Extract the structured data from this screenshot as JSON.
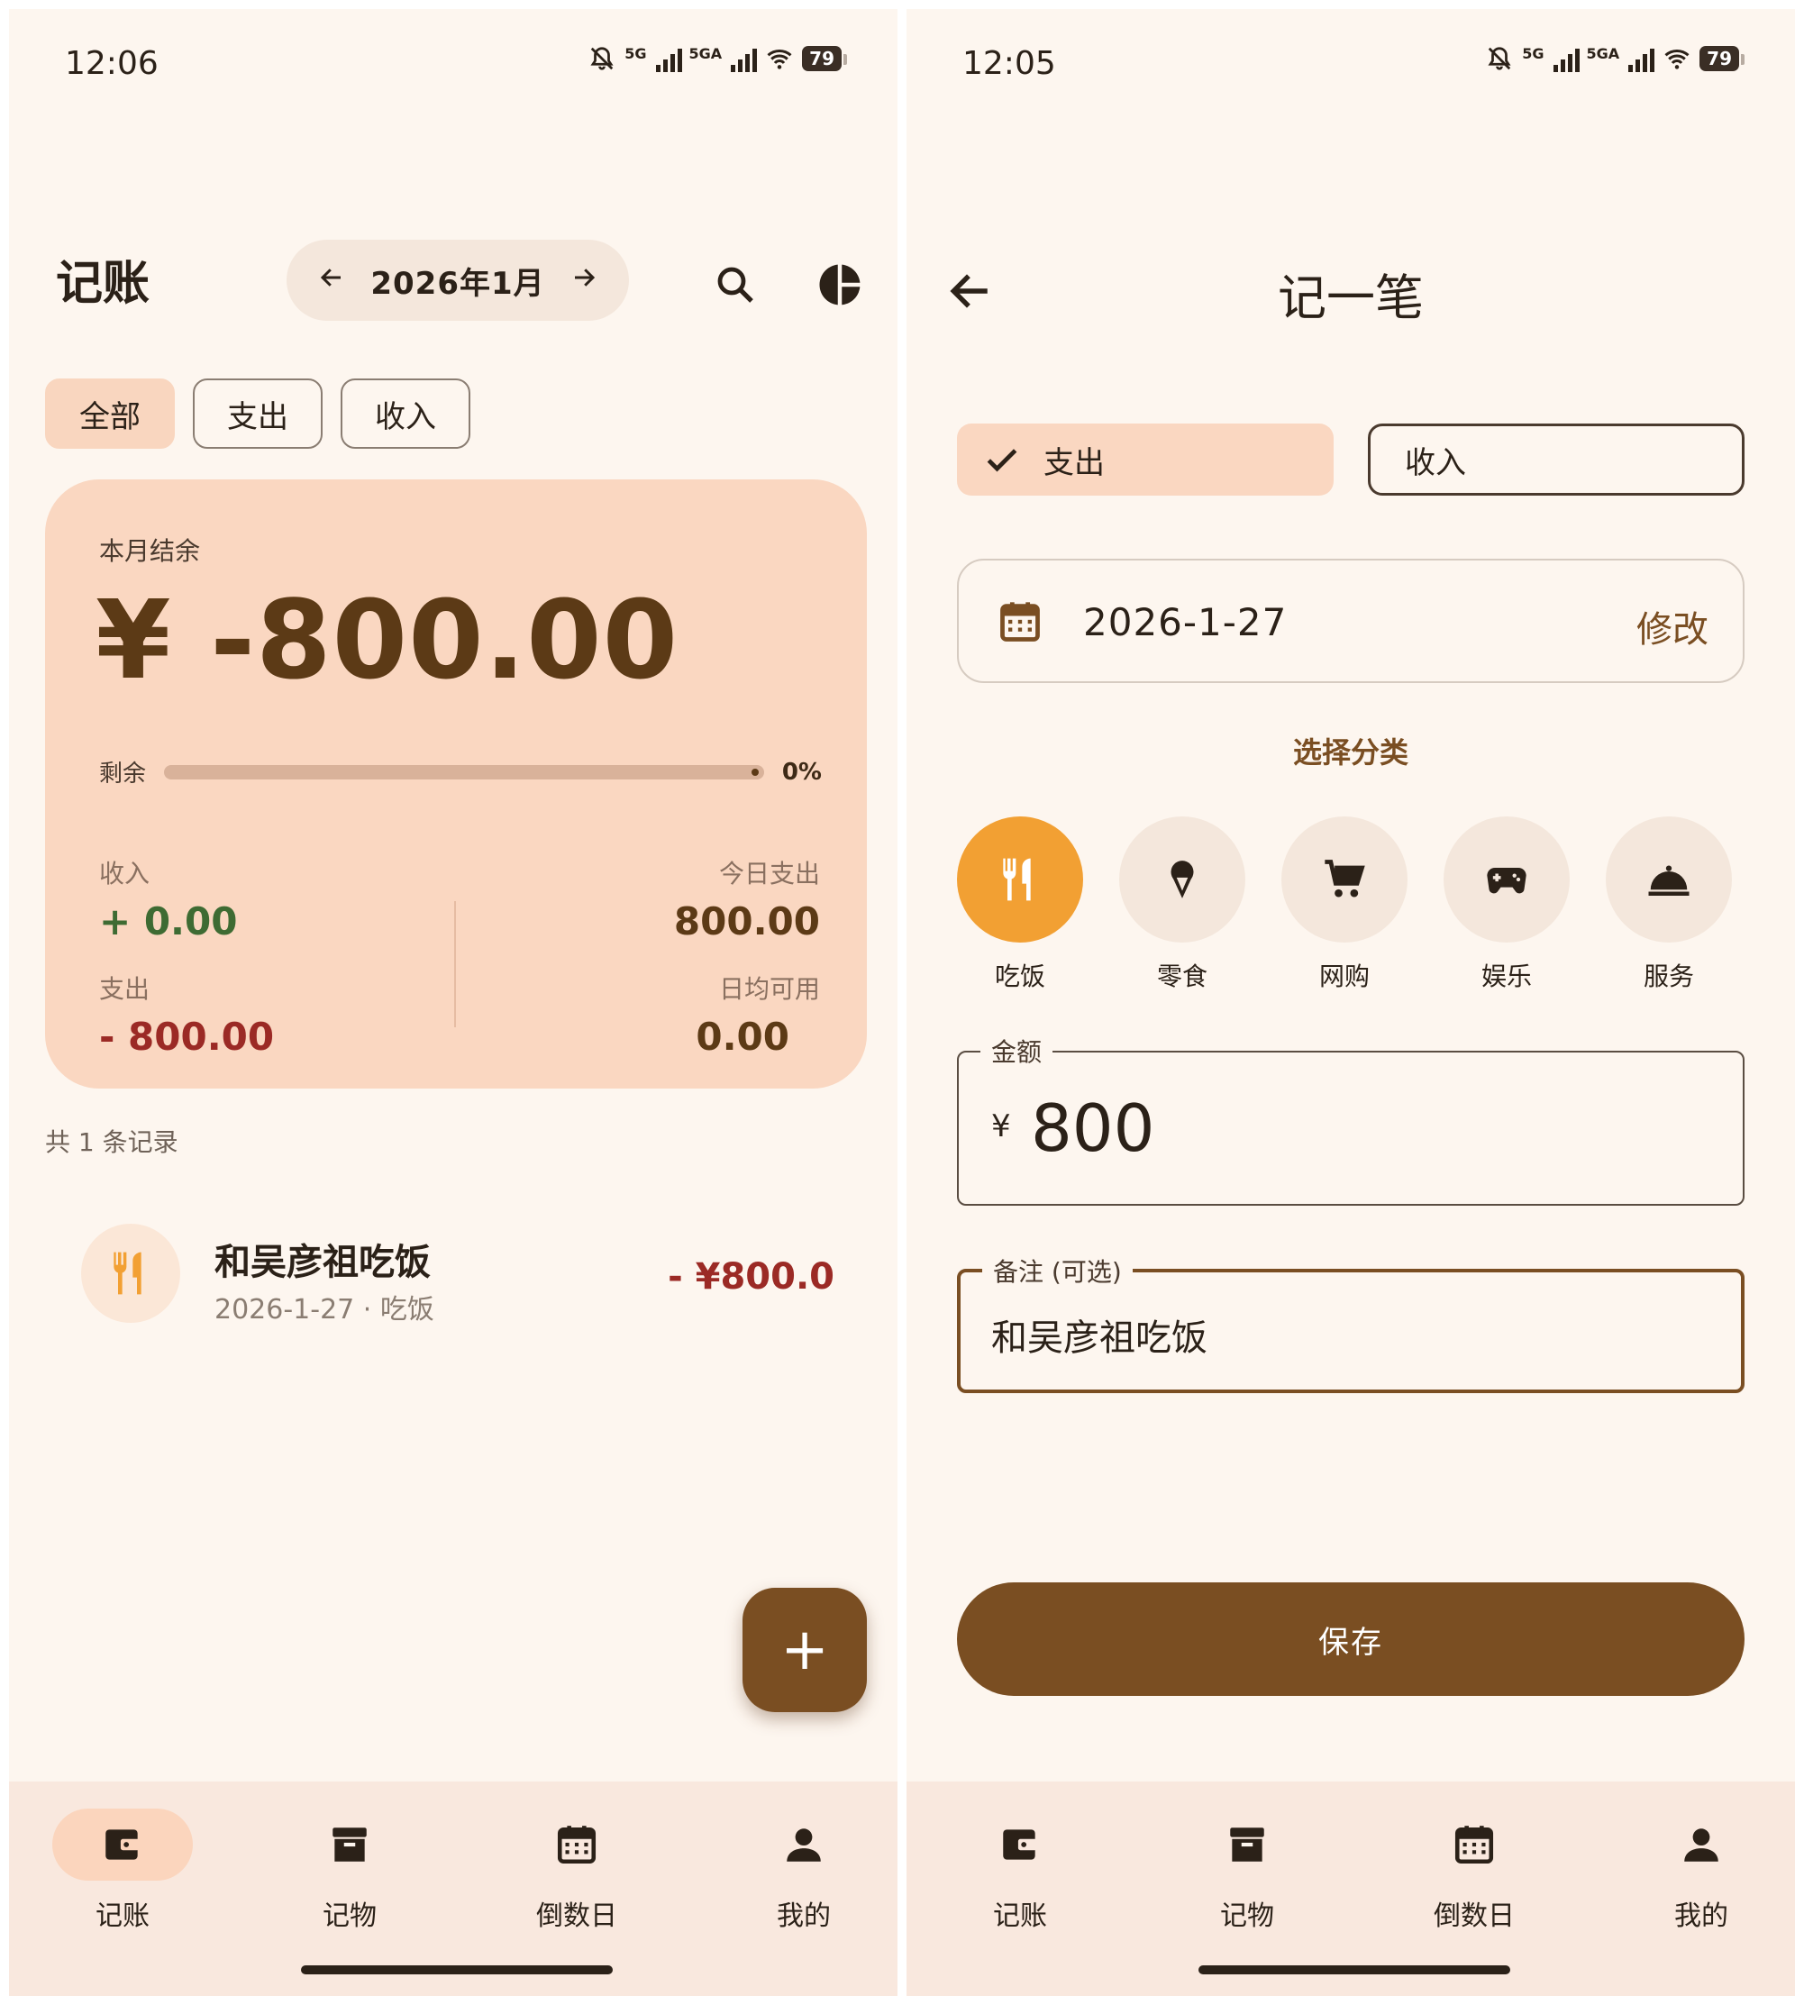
{
  "colors": {
    "background": "#fdf6ef",
    "accent_brown": "#7a4e22",
    "card_peach": "#fad7c1",
    "income_green": "#3e6b33",
    "expense_red": "#9b2a25",
    "category_selected": "#f2a033"
  },
  "left": {
    "status": {
      "time": "12:06",
      "sig1": "5G",
      "sig2": "5GA",
      "battery": "79"
    },
    "header": {
      "title": "记账",
      "month": "2026年1月",
      "prev_icon": "arrow-left-icon",
      "next_icon": "arrow-right-icon",
      "search_icon": "search-icon",
      "chart_icon": "pie-chart-icon"
    },
    "filters": [
      {
        "label": "全部",
        "active": true
      },
      {
        "label": "支出",
        "active": false
      },
      {
        "label": "收入",
        "active": false
      }
    ],
    "summary": {
      "label": "本月结余",
      "balance": "¥ -800.00",
      "remain_label": "剩余",
      "remain_fraction": 0,
      "remain_percent": "0%",
      "income_label": "收入",
      "income_value": "+ 0.00",
      "expense_label": "支出",
      "expense_value": "- 800.00",
      "today_label": "今日支出",
      "today_value": "800.00",
      "daily_label": "日均可用",
      "daily_value": "0.00"
    },
    "record_count": "共 1 条记录",
    "records": [
      {
        "title": "和吴彦祖吃饭",
        "subtitle": "2026-1-27 · 吃饭",
        "amount": "- ¥800.0",
        "icon": "restaurant-icon"
      }
    ],
    "fab_label": "+"
  },
  "right": {
    "status": {
      "time": "12:05",
      "sig1": "5G",
      "sig2": "5GA",
      "battery": "79"
    },
    "title": "记一笔",
    "back_icon": "arrow-back-icon",
    "type_expense": "支出",
    "type_income": "收入",
    "date": "2026-1-27",
    "date_edit": "修改",
    "category_title": "选择分类",
    "categories": [
      {
        "label": "吃饭",
        "icon": "restaurant-icon",
        "selected": true
      },
      {
        "label": "零食",
        "icon": "ice-cream-icon",
        "selected": false
      },
      {
        "label": "网购",
        "icon": "shopping-cart-icon",
        "selected": false
      },
      {
        "label": "娱乐",
        "icon": "gamepad-icon",
        "selected": false
      },
      {
        "label": "服务",
        "icon": "room-service-icon",
        "selected": false
      }
    ],
    "amount_label": "金额",
    "amount_prefix": "¥",
    "amount_value": "800",
    "note_label": "备注 (可选)",
    "note_value": "和吴彦祖吃饭",
    "save_label": "保存"
  },
  "nav": [
    {
      "label": "记账",
      "icon": "wallet-icon"
    },
    {
      "label": "记物",
      "icon": "archive-icon"
    },
    {
      "label": "倒数日",
      "icon": "calendar-icon"
    },
    {
      "label": "我的",
      "icon": "person-icon"
    }
  ]
}
